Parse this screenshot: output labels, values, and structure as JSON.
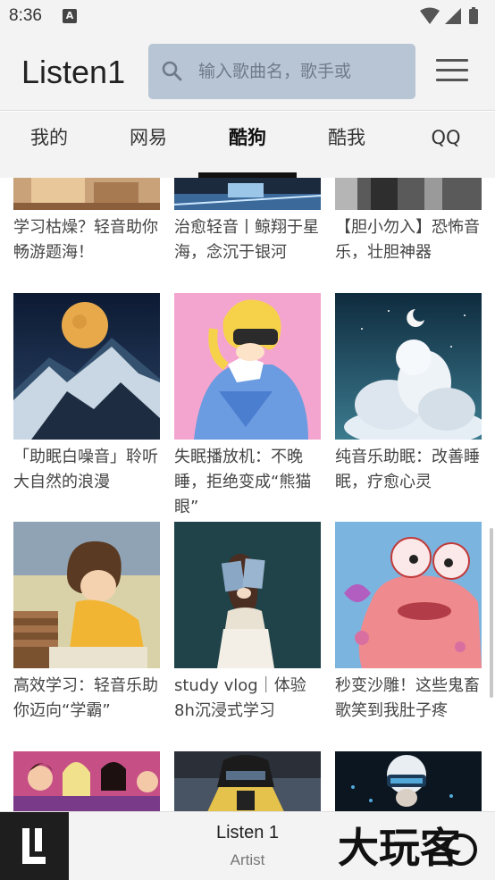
{
  "status": {
    "time": "8:36",
    "notif_icon": "A"
  },
  "app": {
    "title": "Listen1"
  },
  "search": {
    "placeholder": "输入歌曲名，歌手或"
  },
  "tabs": [
    {
      "label": "我的",
      "active": false
    },
    {
      "label": "网易",
      "active": false
    },
    {
      "label": "酷狗",
      "active": true
    },
    {
      "label": "酷我",
      "active": false
    },
    {
      "label": "QQ",
      "active": false
    }
  ],
  "playlists": [
    {
      "title": "学习枯燥？轻音助你畅游题海！"
    },
    {
      "title": "治愈轻音丨鲸翔于星海，念沉于银河"
    },
    {
      "title": "【胆小勿入】恐怖音乐，壮胆神器"
    },
    {
      "title": "「助眠白噪音」聆听大自然的浪漫"
    },
    {
      "title": "失眠播放机：不晚睡，拒绝变成“熊猫眼”"
    },
    {
      "title": "纯音乐助眠：改善睡眠，疗愈心灵"
    },
    {
      "title": "高效学习：轻音乐助你迈向“学霸”"
    },
    {
      "title": "study vlog｜体验8h沉浸式学习"
    },
    {
      "title": "秒变沙雕！这些鬼畜歌笑到我肚子疼"
    }
  ],
  "player": {
    "title": "Listen 1",
    "artist": "Artist"
  },
  "watermark": {
    "text": "大玩客"
  },
  "colors": {
    "search_bg": "#b8c5d4",
    "bar_bg": "#f3f3f3",
    "player_logo_bg": "#1e1e1e"
  },
  "icons": [
    "search-icon",
    "menu-icon",
    "wifi-icon",
    "signal-icon",
    "battery-icon",
    "listen1-logo-icon"
  ]
}
